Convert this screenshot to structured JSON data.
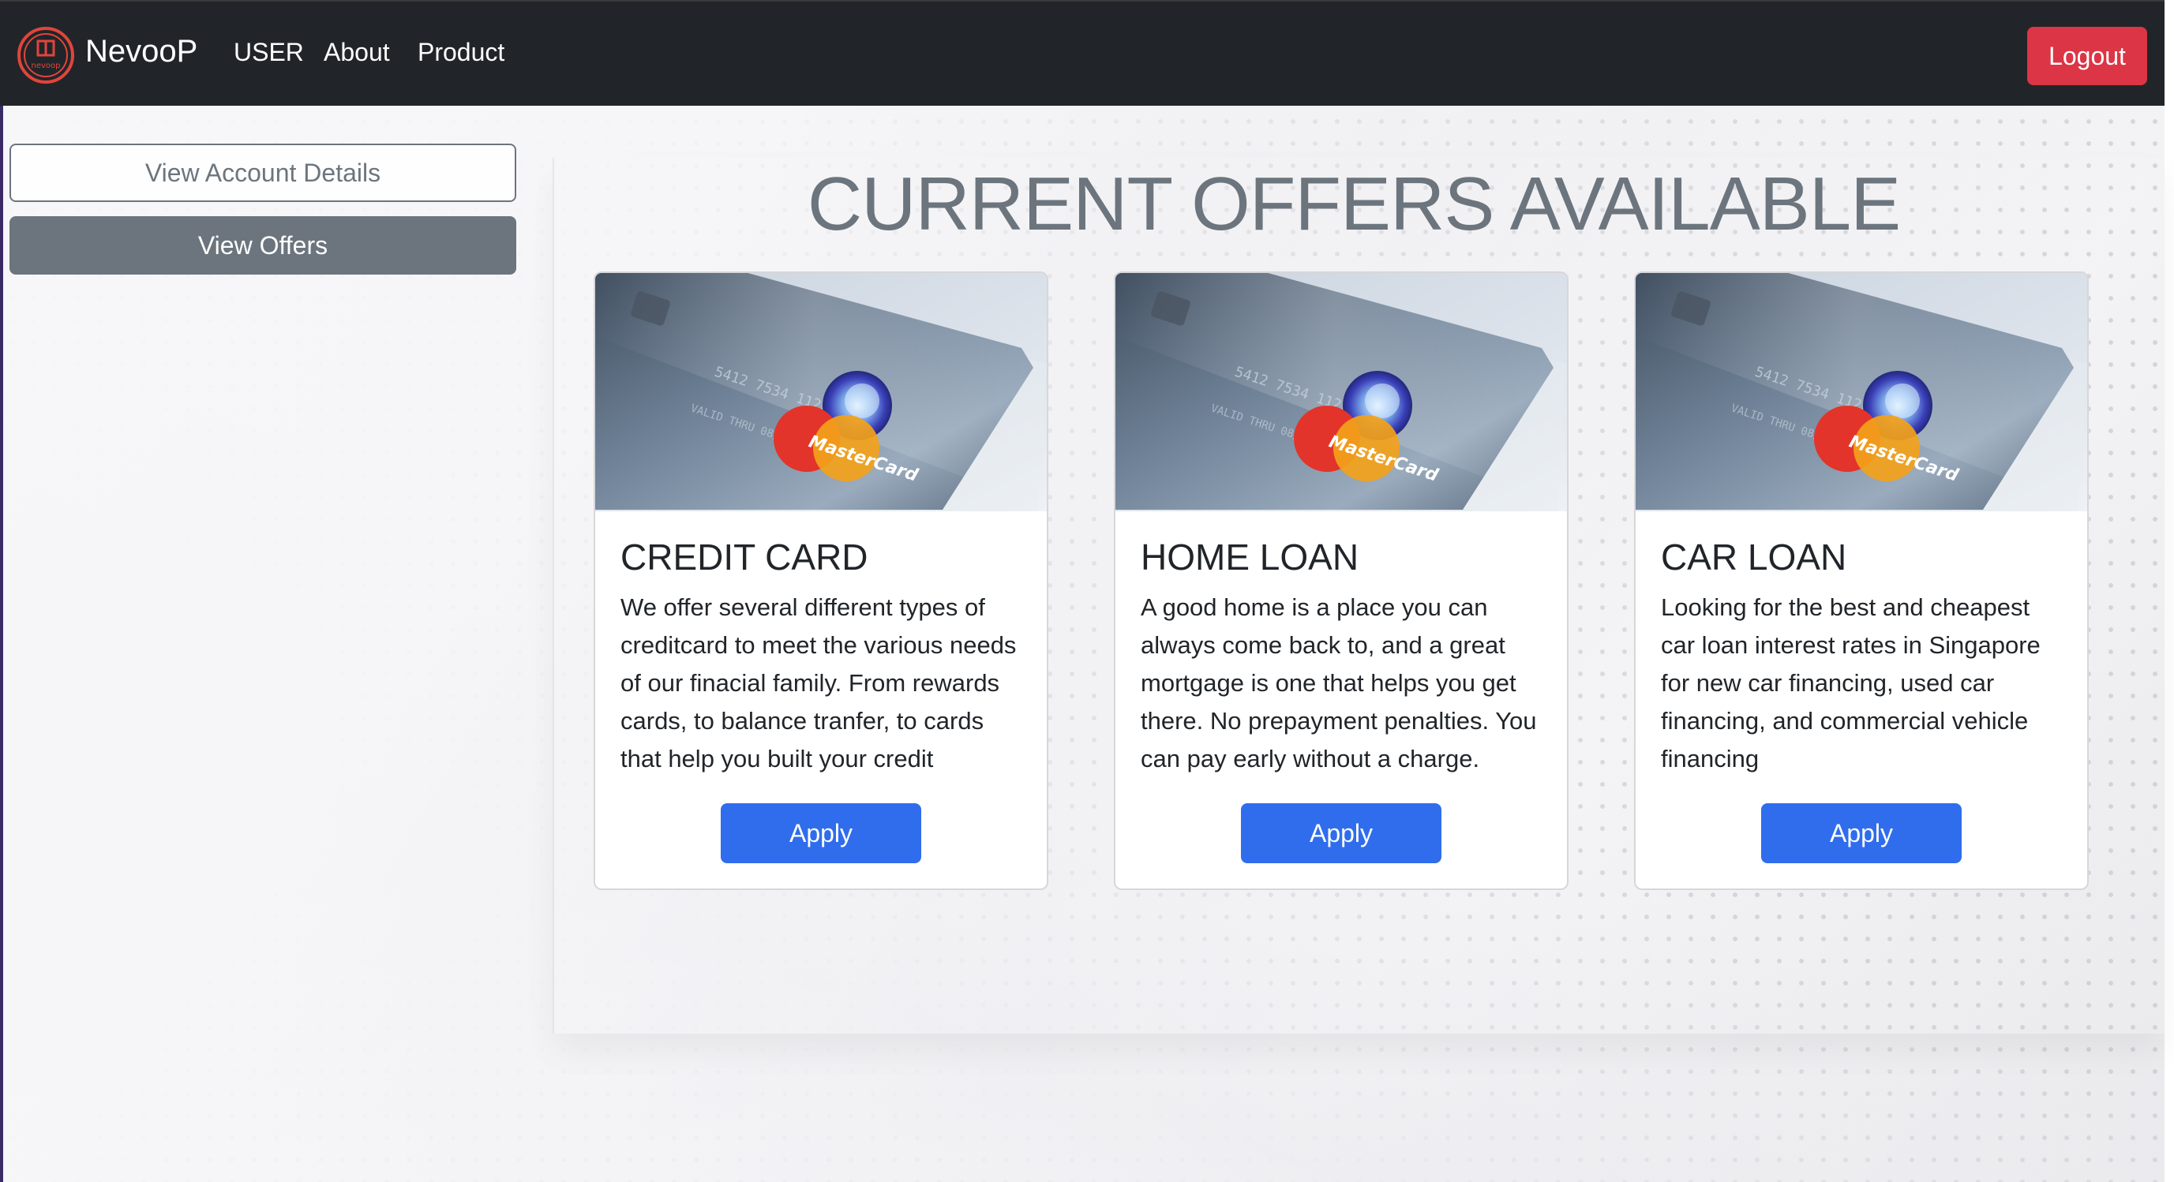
{
  "navbar": {
    "brand": "NevooP",
    "logo_text": "nevoop",
    "links": [
      "USER",
      "About",
      "Product"
    ],
    "logout_label": "Logout"
  },
  "sidebar": {
    "account_details_label": "View Account Details",
    "offers_label": "View Offers"
  },
  "main": {
    "heading": "CURRENT OFFERS AVAILABLE",
    "cards": [
      {
        "title": "CREDIT CARD",
        "text": "We offer several different types of creditcard to meet the various needs of our finacial family. From rewards cards, to balance tranfer, to cards that help you built your credit",
        "button_label": "Apply",
        "image": "mastercard-credit-card-photo"
      },
      {
        "title": "HOME LOAN",
        "text": "A good home is a place you can always come back to, and a great mortgage is one that helps you get there. No prepayment penalties. You can pay early without a charge.",
        "button_label": "Apply",
        "image": "mastercard-credit-card-photo"
      },
      {
        "title": "CAR LOAN",
        "text": "Looking for the best and cheapest car loan interest rates in Singapore for new car financing, used car financing, and commercial vehicle financing",
        "button_label": "Apply",
        "image": "mastercard-credit-card-photo"
      }
    ]
  },
  "colors": {
    "navbar_bg": "#212529",
    "logout_bg": "#dc3545",
    "apply_bg": "#2f6ded",
    "secondary": "#6c757d"
  }
}
